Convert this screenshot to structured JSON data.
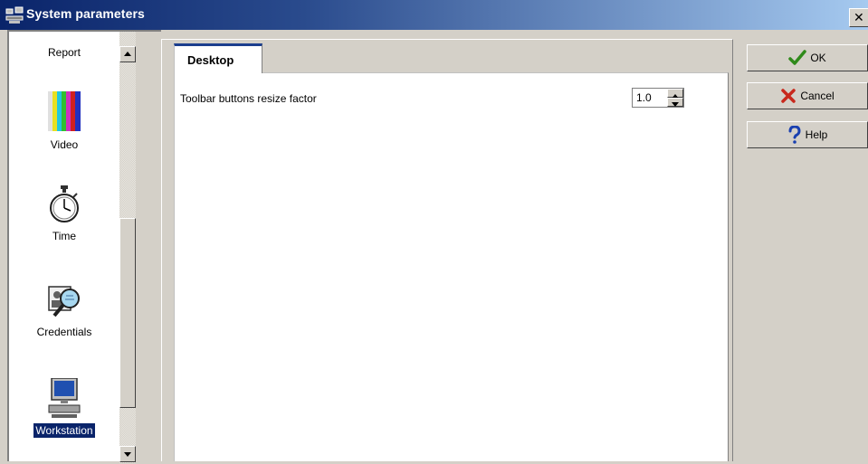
{
  "window": {
    "title": "System parameters",
    "close_glyph": "✕"
  },
  "sidebar": {
    "items": [
      {
        "label": "Report",
        "icon": "report-icon"
      },
      {
        "label": "Video",
        "icon": "video-icon"
      },
      {
        "label": "Time",
        "icon": "stopwatch-icon"
      },
      {
        "label": "Credentials",
        "icon": "credentials-icon"
      },
      {
        "label": "Workstation",
        "icon": "workstation-icon",
        "selected": true
      }
    ],
    "scrollbar": {
      "up_glyph": "▲",
      "down_glyph": "▼"
    }
  },
  "main": {
    "tabs": [
      {
        "label": "Desktop",
        "active": true
      }
    ],
    "settings": [
      {
        "label": "Toolbar buttons resize factor",
        "value": "1.0"
      }
    ]
  },
  "buttons": {
    "ok": {
      "label": "OK",
      "icon": "checkmark-icon",
      "color": "#2f8a1a"
    },
    "cancel": {
      "label": "Cancel",
      "icon": "x-mark-icon",
      "color": "#c8281c"
    },
    "help": {
      "label": "Help",
      "icon": "question-mark-icon",
      "color": "#1a40b0"
    }
  }
}
